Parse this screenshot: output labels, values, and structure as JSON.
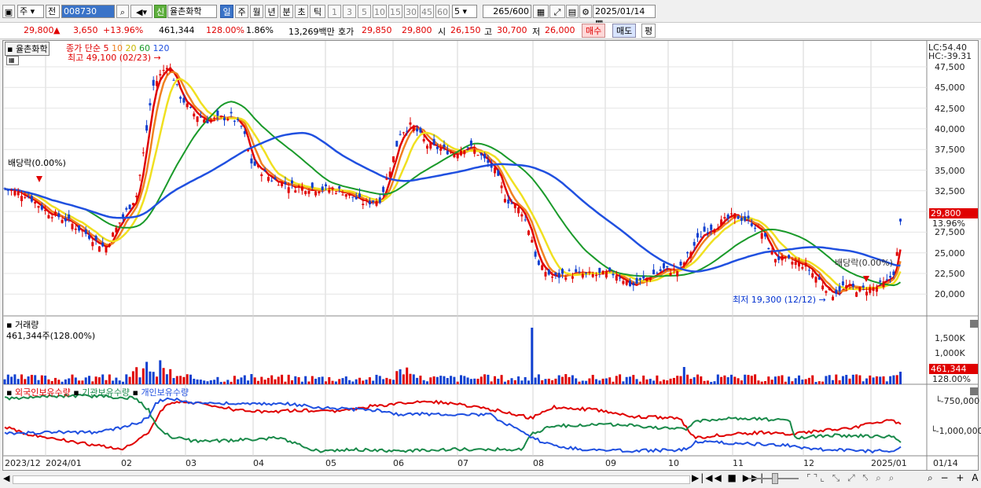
{
  "toolbar": {
    "market": "주",
    "prev": "전",
    "code": "008730",
    "stock_badge": "신",
    "stock_name": "율촌화학",
    "periods": [
      "일",
      "주",
      "월",
      "년",
      "분",
      "초",
      "틱"
    ],
    "active_period": "일",
    "intervals": [
      "1",
      "3",
      "5",
      "10",
      "15",
      "30",
      "45",
      "60"
    ],
    "interval_select": "5",
    "count": "265",
    "count_total": "/600",
    "date": "2025/01/14"
  },
  "quote": {
    "price": "29,800",
    "arrow": "▲",
    "change": "3,650",
    "change_pct": "+13.96%",
    "volume": "461,344",
    "volume_ratio": "128.00%",
    "turnover": "1.86%",
    "amount": "13,269백만",
    "bid_label": "호가",
    "ask": "29,850",
    "bid": "29,800",
    "open_label": "시",
    "open": "26,150",
    "high_label": "고",
    "high": "30,700",
    "low_label": "저",
    "low": "26,000",
    "buy_btn": "매수",
    "sell_btn": "매도",
    "eval_btn": "평"
  },
  "price_panel": {
    "stock": "율촌화학",
    "ma_label": "종가 단순",
    "ma_periods": [
      "5",
      "10",
      "20",
      "60",
      "120"
    ],
    "ma_colors": [
      "#e00000",
      "#f08020",
      "#f0e020",
      "#1a9a2a",
      "#2050e0"
    ],
    "high_note": "최고 49,100 (02/23)",
    "low_note": "최저 19,300 (12/12)",
    "div_note_left": "배당락(0.00%)",
    "div_note_right": "배당락(0.00%)",
    "lc": "LC:54.40",
    "hc": "HC:-39.31",
    "y_ticks": [
      "47,500",
      "45,000",
      "42,500",
      "40,000",
      "37,500",
      "35,000",
      "32,500",
      "30,000",
      "27,500",
      "25,000",
      "22,500",
      "20,000"
    ],
    "last_price": "29,800",
    "last_pct": "13.96%"
  },
  "volume_panel": {
    "title": "거래량",
    "value": "461,344주(128.00%)",
    "y_ticks": [
      "1,500K",
      "1,000K"
    ],
    "last_value": "461,344",
    "last_pct": "128.00%"
  },
  "holdings_panel": {
    "series": [
      "외국인보유수량",
      "기관보유수량",
      "개인보유수량"
    ],
    "colors": [
      "#e00000",
      "#1a8a4a",
      "#2050e0"
    ],
    "y_ticks": [
      "-750,000",
      "-1,000,000"
    ]
  },
  "x_axis": [
    "2023/12",
    "2024/01",
    "02",
    "03",
    "04",
    "05",
    "06",
    "07",
    "08",
    "09",
    "10",
    "11",
    "12",
    "2025/01",
    "01/14"
  ]
}
